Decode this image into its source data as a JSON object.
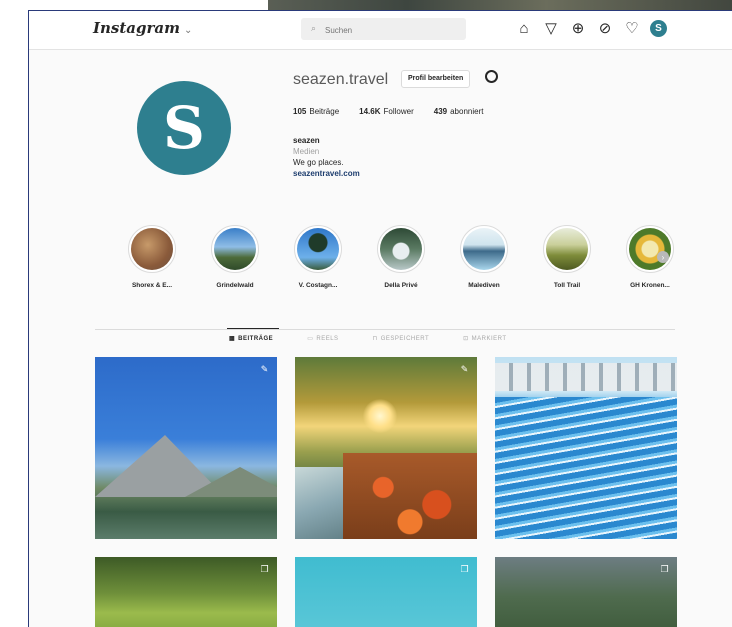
{
  "header": {
    "logo": "Instagram",
    "search_placeholder": "Suchen",
    "nav_icons": [
      "home-icon",
      "direct-icon",
      "new-post-icon",
      "explore-icon",
      "activity-icon",
      "profile-avatar"
    ]
  },
  "profile": {
    "avatar_letter": "S",
    "username": "seazen.travel",
    "edit_button": "Profil bearbeiten",
    "stats": [
      {
        "value": "105",
        "label": "Beiträge"
      },
      {
        "value": "14.6K",
        "label": "Follower"
      },
      {
        "value": "439",
        "label": "abonniert"
      }
    ],
    "bio": {
      "name": "seazen",
      "category": "Medien",
      "text": "We go places.",
      "link": "seazentravel.com"
    }
  },
  "highlights": [
    {
      "label": "Shorex & E..."
    },
    {
      "label": "Grindelwald"
    },
    {
      "label": "V. Costagn..."
    },
    {
      "label": "Della Privé"
    },
    {
      "label": "Malediven"
    },
    {
      "label": "Toll Trail"
    },
    {
      "label": "GH Kronen..."
    }
  ],
  "tabs": [
    {
      "label": "BEITRÄGE",
      "active": true
    },
    {
      "label": "REELS",
      "active": false
    },
    {
      "label": "GESPEICHERT",
      "active": false
    },
    {
      "label": "MARKIERT",
      "active": false
    }
  ],
  "colors": {
    "brand": "#2e7f8f",
    "text": "#262626",
    "muted": "#a8a8a8"
  }
}
